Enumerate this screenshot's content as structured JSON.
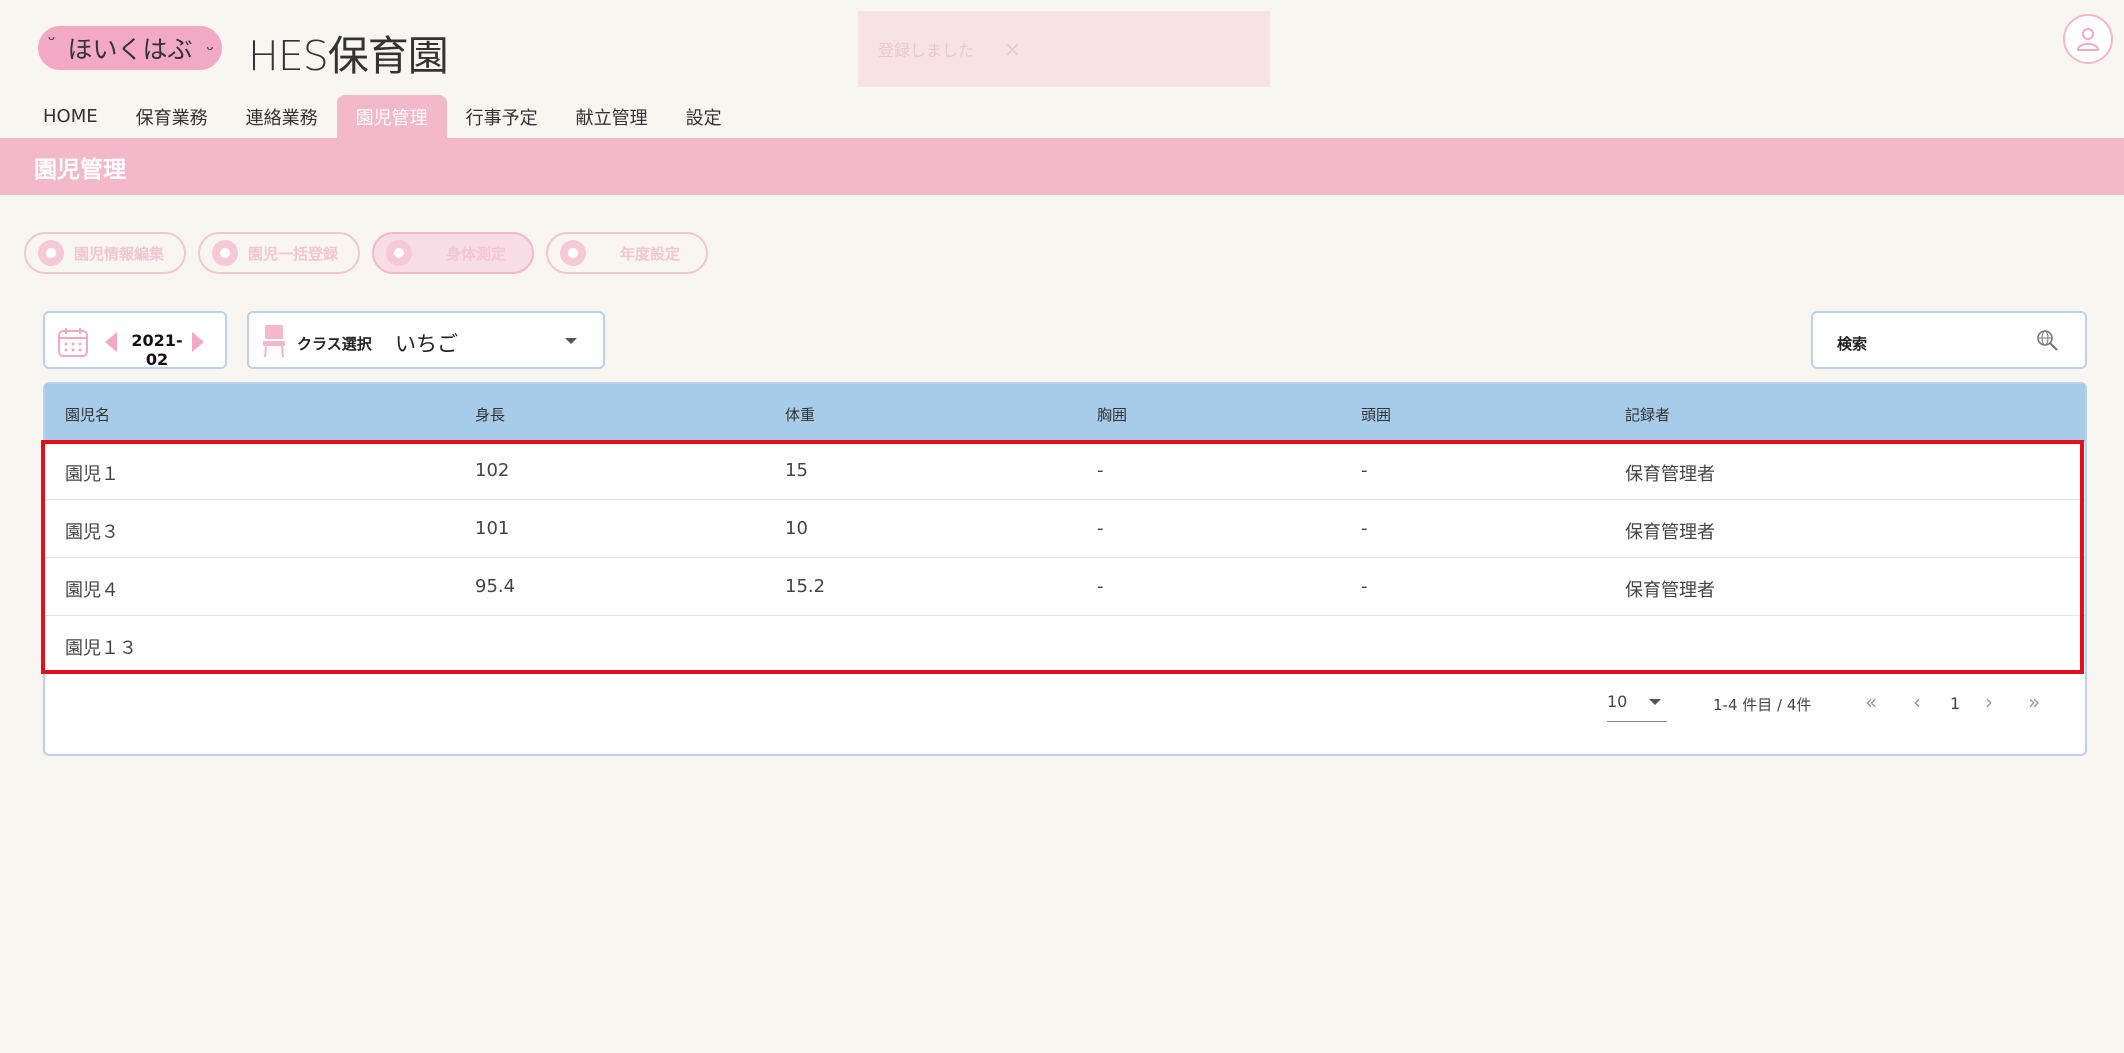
{
  "header": {
    "logo_text": "ほいくはぶ",
    "site_title": "HES保育園",
    "toast_text": "登録しました",
    "toast_close": "×"
  },
  "nav": {
    "items": [
      {
        "label": "HOME"
      },
      {
        "label": "保育業務"
      },
      {
        "label": "連絡業務"
      },
      {
        "label": "園児管理"
      },
      {
        "label": "行事予定"
      },
      {
        "label": "献立管理"
      },
      {
        "label": "設定"
      }
    ],
    "active_index": 3
  },
  "page": {
    "title": "園児管理"
  },
  "actions": [
    {
      "label": "園児情報編集"
    },
    {
      "label": "園児一括登録"
    },
    {
      "label": "身体測定"
    },
    {
      "label": "年度設定"
    }
  ],
  "filters": {
    "month": "2021-02",
    "class_label": "クラス選択",
    "class_value": "いちご",
    "search_placeholder": "検索"
  },
  "table": {
    "headers": [
      "園児名",
      "身長",
      "体重",
      "胸囲",
      "頭囲",
      "記録者"
    ],
    "rows": [
      {
        "name": "園児１",
        "height": "102",
        "weight": "15",
        "chest": "-",
        "head": "-",
        "recorder": "保育管理者"
      },
      {
        "name": "園児３",
        "height": "101",
        "weight": "10",
        "chest": "-",
        "head": "-",
        "recorder": "保育管理者"
      },
      {
        "name": "園児４",
        "height": "95.4",
        "weight": "15.2",
        "chest": "-",
        "head": "-",
        "recorder": "保育管理者"
      },
      {
        "name": "園児１３",
        "height": "",
        "weight": "",
        "chest": "",
        "head": "",
        "recorder": ""
      }
    ]
  },
  "pagination": {
    "per_page": "10",
    "range_text": "1-4 件目 / 4件",
    "current_page": "1"
  },
  "colors": {
    "accent_pink": "#f3b8ca",
    "header_blue": "#a9cbea",
    "highlight_red": "#e0101e"
  }
}
